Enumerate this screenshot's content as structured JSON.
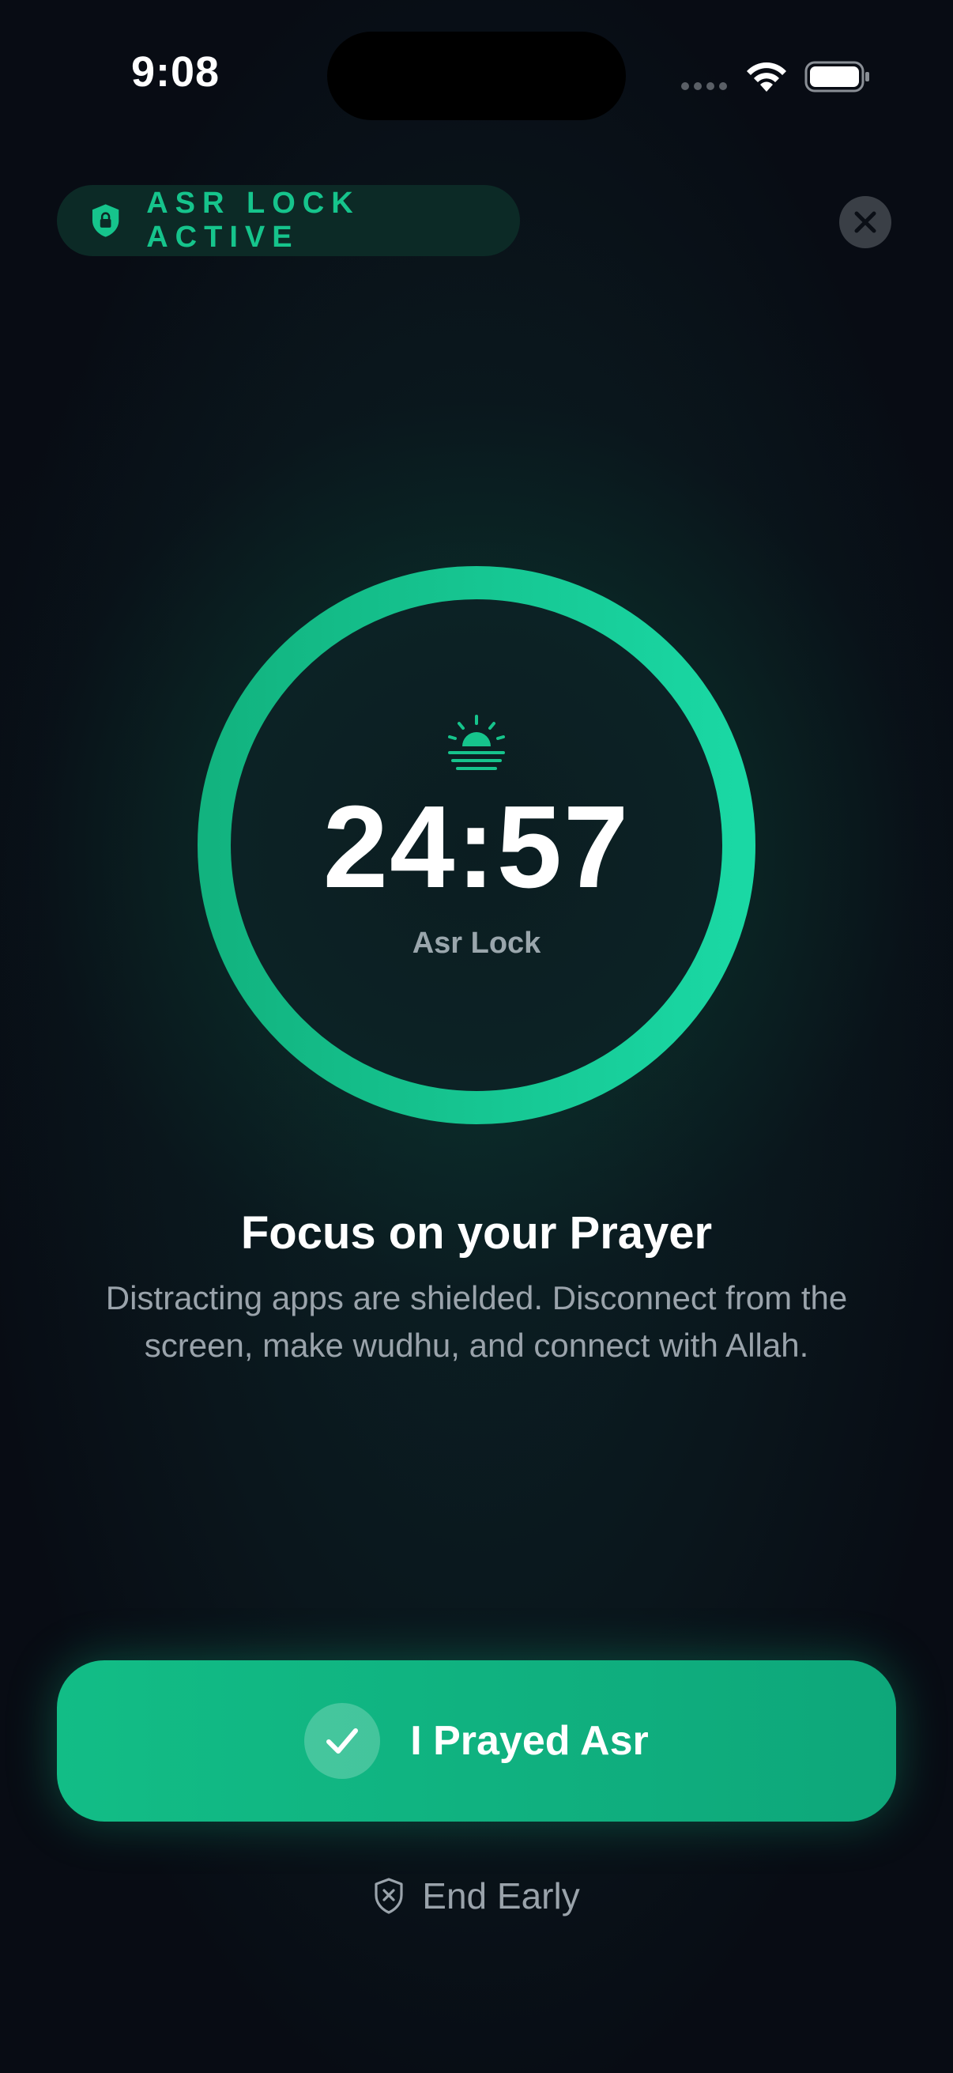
{
  "status_bar": {
    "time": "9:08"
  },
  "badge": {
    "label": "ASR LOCK ACTIVE",
    "icon": "lock-shield-icon"
  },
  "close": {
    "icon": "close-icon"
  },
  "timer": {
    "icon": "sunset-icon",
    "value": "24:57",
    "label": "Asr Lock",
    "progress": 1.0
  },
  "message": {
    "title": "Focus on your Prayer",
    "body": "Distracting apps are shielded. Disconnect from the screen, make wudhu, and connect with Allah."
  },
  "actions": {
    "prayed_label": "I Prayed Asr",
    "prayed_icon": "check-icon",
    "end_early_label": "End Early",
    "end_early_icon": "shield-x-icon"
  },
  "colors": {
    "accent": "#16c48c",
    "background": "#080c14",
    "muted_text": "#9aa3ab"
  }
}
